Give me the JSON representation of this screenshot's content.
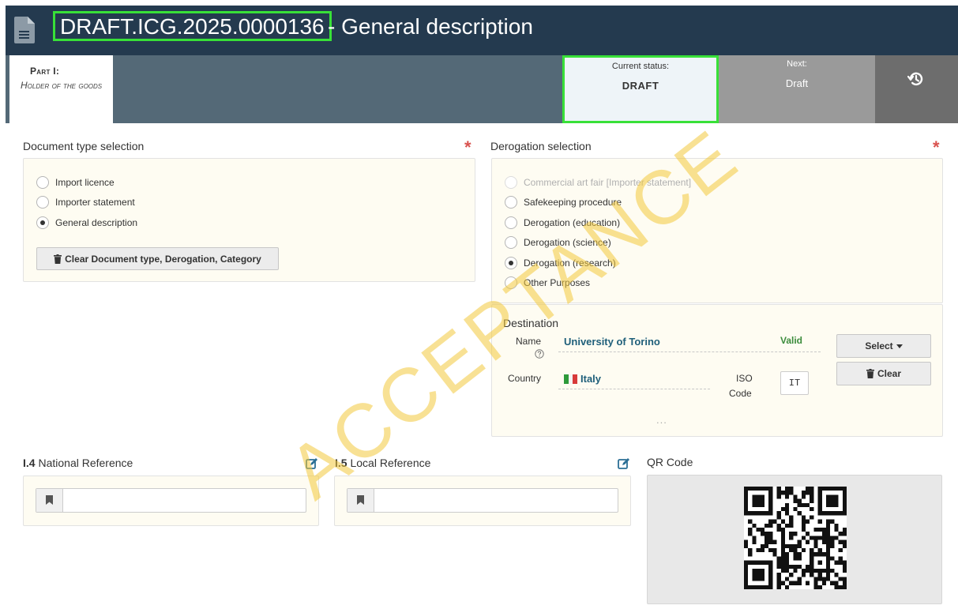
{
  "header": {
    "doc_id": "DRAFT.ICG.2025.0000136",
    "doc_title": "- General description",
    "icon": "document-icon"
  },
  "statusbar": {
    "part_label": "Part I:",
    "part_name": "Holder of the goods",
    "current_status_label": "Current status:",
    "current_status_value": "DRAFT",
    "next_label": "Next:",
    "next_value": "Draft",
    "history_icon": "history-icon"
  },
  "doc_type": {
    "title": "Document type selection",
    "required_mark": "*",
    "options": [
      {
        "label": "Import licence",
        "checked": false
      },
      {
        "label": "Importer statement",
        "checked": false
      },
      {
        "label": "General description",
        "checked": true
      }
    ],
    "clear_button": "Clear Document type, Derogation, Category"
  },
  "derogation": {
    "title": "Derogation selection",
    "required_mark": "*",
    "options": [
      {
        "label": "Commercial art fair [Importer statement]",
        "checked": false,
        "disabled": true
      },
      {
        "label": "Safekeeping procedure",
        "checked": false
      },
      {
        "label": "Derogation (education)",
        "checked": false
      },
      {
        "label": "Derogation (science)",
        "checked": false
      },
      {
        "label": "Derogation (research)",
        "checked": true
      },
      {
        "label": "Other Purposes",
        "checked": false
      }
    ]
  },
  "destination": {
    "title": "Destination",
    "name_label": "Name",
    "name_value": "University of Torino",
    "valid_label": "Valid",
    "country_label": "Country",
    "country_value": "Italy",
    "iso_label_1": "ISO",
    "iso_label_2": "Code",
    "iso_value": "IT",
    "select_button": "Select",
    "clear_button": "Clear",
    "more": "..."
  },
  "references": {
    "national_num": "I.4",
    "national_label": "National Reference",
    "national_value": "",
    "local_num": "I.5",
    "local_label": "Local Reference",
    "local_value": ""
  },
  "qr": {
    "title": "QR Code"
  },
  "watermark": "ACCEPTANCE",
  "colors": {
    "header_bg": "#243a4f",
    "statusbar_bg": "#546977",
    "highlight": "#38e038",
    "required": "#d9534f",
    "valid": "#3c8c3c",
    "link": "#1f5f7a"
  }
}
